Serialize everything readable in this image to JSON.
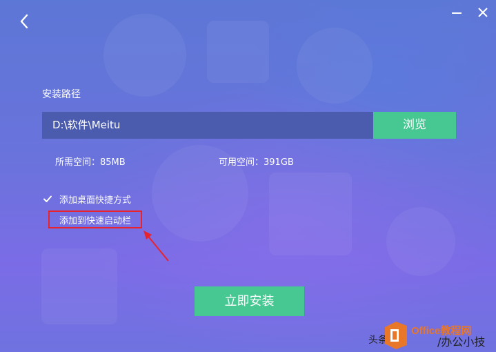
{
  "header": {
    "back_icon": "chevron-left-icon",
    "minimize_icon": "minimize-icon",
    "close_icon": "close-icon"
  },
  "install": {
    "path_label": "安装路径",
    "path_value": "D:\\软件\\Meitu",
    "browse_label": "浏览",
    "required_space": "所需空间：85MB",
    "available_space": "可用空间：391GB"
  },
  "options": {
    "desktop_shortcut": {
      "label": "添加桌面快捷方式",
      "checked": true
    },
    "quick_launch": {
      "label": "添加到快速启动栏",
      "checked": false
    }
  },
  "actions": {
    "install_label": "立即安装"
  },
  "annotation": {
    "highlight_color": "#e8232d"
  },
  "watermark": {
    "source": "头条号",
    "site": "Office教程网",
    "brand": "/办公小技巧",
    "logo_color": "#e8772a"
  },
  "colors": {
    "accent_green": "#47c792",
    "path_field_bg": "#4b5cae"
  }
}
